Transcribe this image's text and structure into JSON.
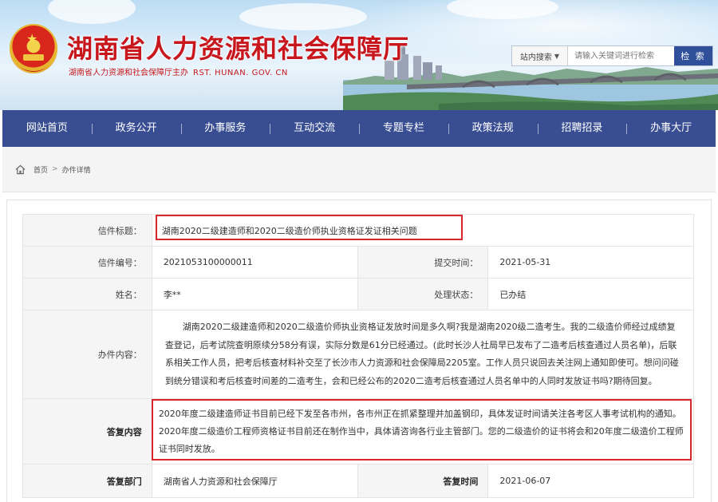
{
  "header": {
    "site_title": "湖南省人力资源和社会保障厅",
    "site_subtitle": "湖南省人力资源和社会保障厅主办",
    "site_url": "RST. HUNAN. GOV. CN",
    "search": {
      "scope_label": "站内搜索",
      "placeholder": "请输入关键词进行检索",
      "button_label": "检 索"
    }
  },
  "nav": {
    "items": [
      {
        "label": "网站首页"
      },
      {
        "label": "政务公开"
      },
      {
        "label": "办事服务"
      },
      {
        "label": "互动交流"
      },
      {
        "label": "专题专栏"
      },
      {
        "label": "政策法规"
      },
      {
        "label": "招聘招录"
      },
      {
        "label": "办事大厅"
      }
    ]
  },
  "breadcrumb": {
    "home_label": "首页",
    "separator": ">",
    "current": "办件详情"
  },
  "letter": {
    "title_label": "信件标题：",
    "title": "湖南2020二级建造师和2020二级造价师执业资格证发证相关问题",
    "number_label": "信件编号：",
    "number": "2021053100000011",
    "submit_time_label": "提交时间：",
    "submit_time": "2021-05-31",
    "name_label": "姓名：",
    "name": "李**",
    "status_label": "处理状态：",
    "status": "已办结",
    "content_label": "办件内容：",
    "content": "湖南2020二级建造师和2020二级造价师执业资格证发放时间是多久啊?我是湖南2020级二造考生。我的二级造价师经过成绩复查登记，后考试院查明原续分58分有误，实际分数是61分已经通过。(此时长沙人社局早已发布了二造考后核查通过人员名单)，后联系相关工作人员，把考后核查材料补交至了长沙市人力资源和社会保障局2205室。工作人员只说回去关注网上通知即使可。想问问碰到统分错误和考后核查时间差的二造考生，会和已经公布的2020二造考后核查通过人员名单中的人同时发放证书吗?期待回复。",
    "reply_label": "答复内容",
    "reply_lines": [
      "2020年度二级建造师证书目前已经下发至各市州，各市州正在抓紧整理并加盖钢印，具体发证时间请关注各考区人事考试机构的通知。",
      "2020年度二级造价工程师资格证书目前还在制作当中，具体请咨询各行业主管部门。您的二级造价的证书将会和20年度二级造价工程师证书同时发放。"
    ],
    "reply_dept_label": "答复部门",
    "reply_dept": "湖南省人力资源和社会保障厅",
    "reply_time_label": "答复时间",
    "reply_time": "2021-06-07"
  },
  "colors": {
    "nav_bg": "#394e92",
    "brand_red": "#c8161d",
    "highlight_red": "#d8262f",
    "search_button": "#2f4f9a"
  }
}
